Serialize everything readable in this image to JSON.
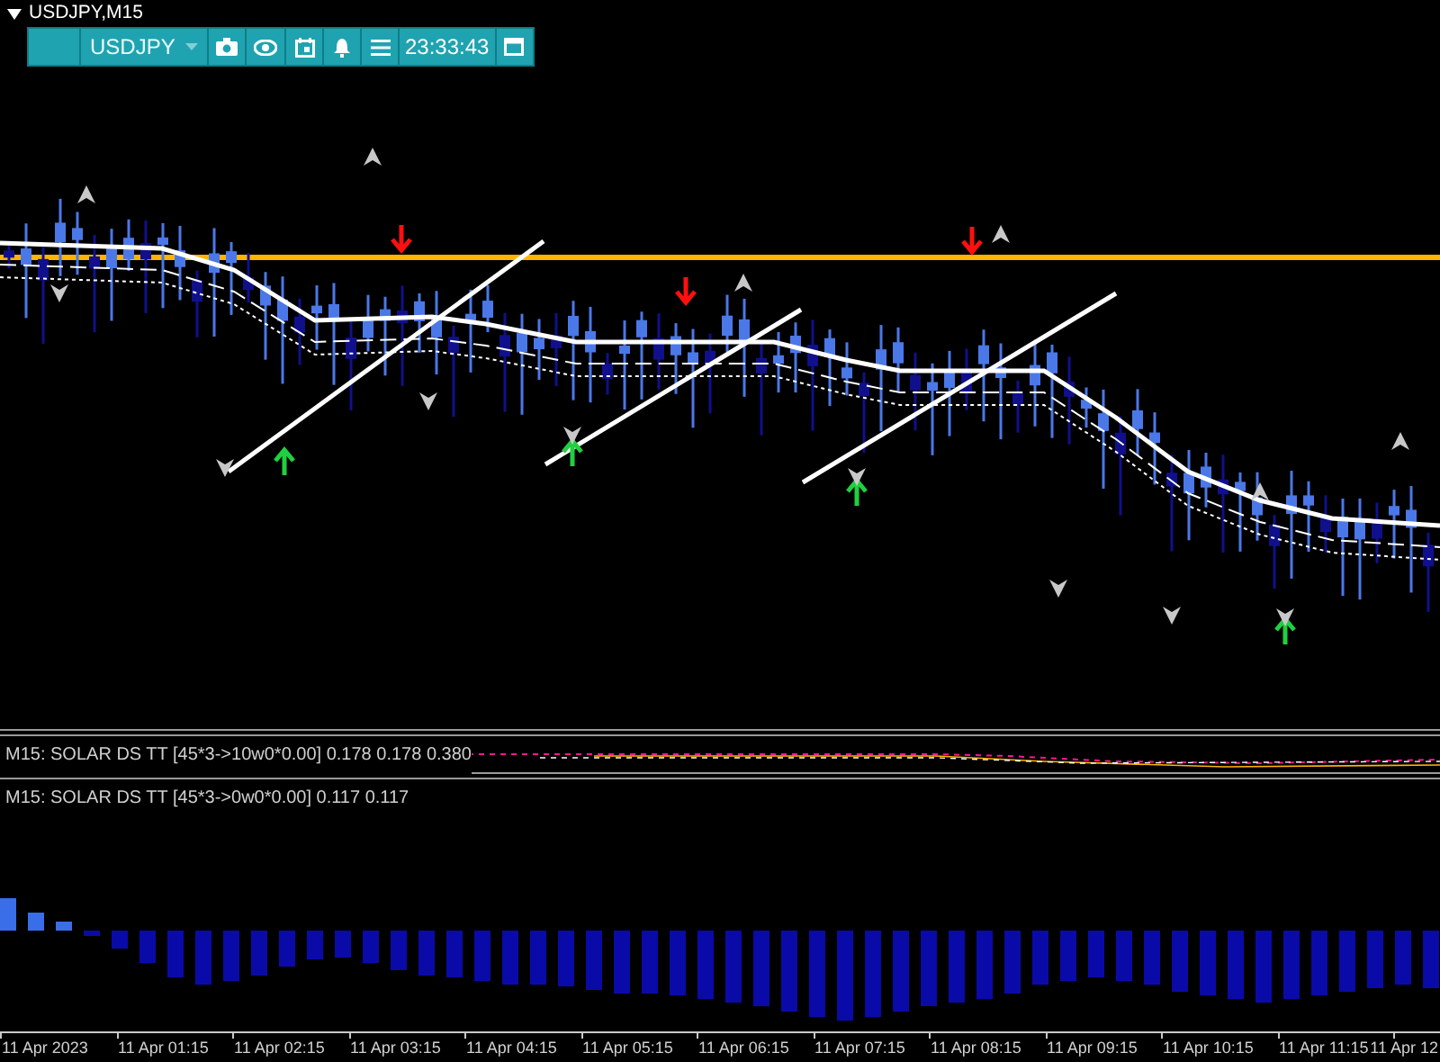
{
  "chart": {
    "title": "USDJPY,M15"
  },
  "toolbar": {
    "symbol": "USDJPY",
    "time": "23:33:43"
  },
  "indicators": [
    {
      "label": "M15: SOLAR DS TT [45*3->10w0*0.00] 0.178 0.178 0.380"
    },
    {
      "label": "M15: SOLAR DS TT [45*3->0w0*0.00] 0.117 0.117"
    }
  ],
  "time_axis": [
    "11 Apr 2023",
    "11 Apr 01:15",
    "11 Apr 02:15",
    "11 Apr 03:15",
    "11 Apr 04:15",
    "11 Apr 05:15",
    "11 Apr 06:15",
    "11 Apr 07:15",
    "11 Apr 08:15",
    "11 Apr 09:15",
    "11 Apr 10:15",
    "11 Apr 11:15",
    "11 Apr 12"
  ]
}
